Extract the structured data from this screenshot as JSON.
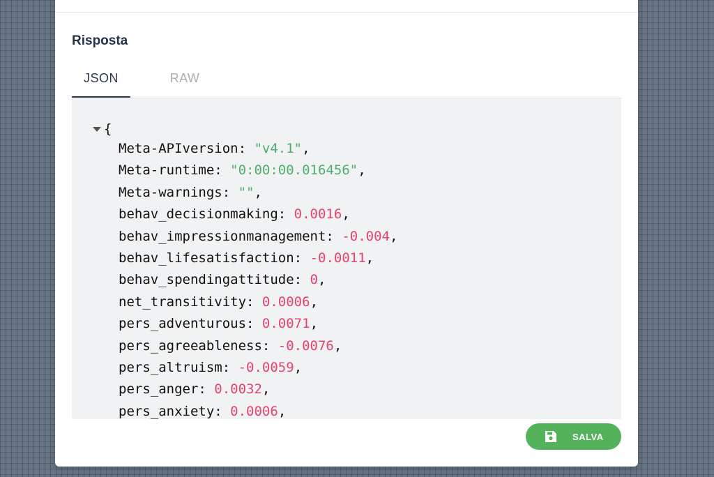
{
  "panel": {
    "title": "Risposta"
  },
  "tabs": [
    {
      "label": "JSON",
      "active": true
    },
    {
      "label": "RAW",
      "active": false
    }
  ],
  "viewer": {
    "open_brace": "{",
    "entries": [
      {
        "key": "Meta-APIversion",
        "display": "\"v4.1\"",
        "type": "string"
      },
      {
        "key": "Meta-runtime",
        "display": "\"0:00:00.016456\"",
        "type": "string"
      },
      {
        "key": "Meta-warnings",
        "display": "\"\"",
        "type": "string"
      },
      {
        "key": "behav_decisionmaking",
        "display": "0.0016",
        "type": "number"
      },
      {
        "key": "behav_impressionmanagement",
        "display": "-0.004",
        "type": "number"
      },
      {
        "key": "behav_lifesatisfaction",
        "display": "-0.0011",
        "type": "number"
      },
      {
        "key": "behav_spendingattitude",
        "display": "0",
        "type": "number"
      },
      {
        "key": "net_transitivity",
        "display": "0.0006",
        "type": "number"
      },
      {
        "key": "pers_adventurous",
        "display": "0.0071",
        "type": "number"
      },
      {
        "key": "pers_agreeableness",
        "display": "-0.0076",
        "type": "number"
      },
      {
        "key": "pers_altruism",
        "display": "-0.0059",
        "type": "number"
      },
      {
        "key": "pers_anger",
        "display": "0.0032",
        "type": "number"
      },
      {
        "key": "pers_anxiety",
        "display": "0.0006",
        "type": "number"
      }
    ]
  },
  "save_button": {
    "label": "SALVA",
    "icon": "floppy-disk-icon"
  },
  "colors": {
    "accent": "#54b25b",
    "string": "#4caf6e",
    "number": "#e5436b",
    "title": "#24324a"
  }
}
